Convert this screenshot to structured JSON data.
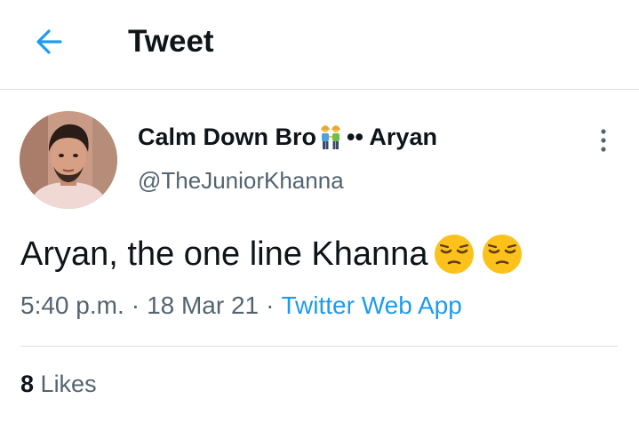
{
  "header": {
    "title": "Tweet",
    "back_icon": "arrow-left-icon",
    "accent_color": "#1d9bf0"
  },
  "tweet": {
    "author": {
      "display_name_prefix": "Calm Down Bro",
      "display_name_emoji": "people-holding-hands-emoji",
      "display_name_suffix": "•• Aryan",
      "handle": "@TheJuniorKhanna",
      "avatar": "user-avatar-photo"
    },
    "more_icon": "vertical-ellipsis-icon",
    "text": "Aryan, the one line Khanna",
    "text_emojis": [
      "pensive-face-emoji",
      "pensive-face-emoji"
    ],
    "time": "5:40 p.m.",
    "date": "18 Mar 21",
    "separator": "·",
    "source": "Twitter Web App",
    "likes_count": "8",
    "likes_label": "Likes"
  },
  "colors": {
    "text_primary": "#0f1419",
    "text_secondary": "#536471",
    "link": "#1d9bf0",
    "divider": "#dcdfe2"
  }
}
